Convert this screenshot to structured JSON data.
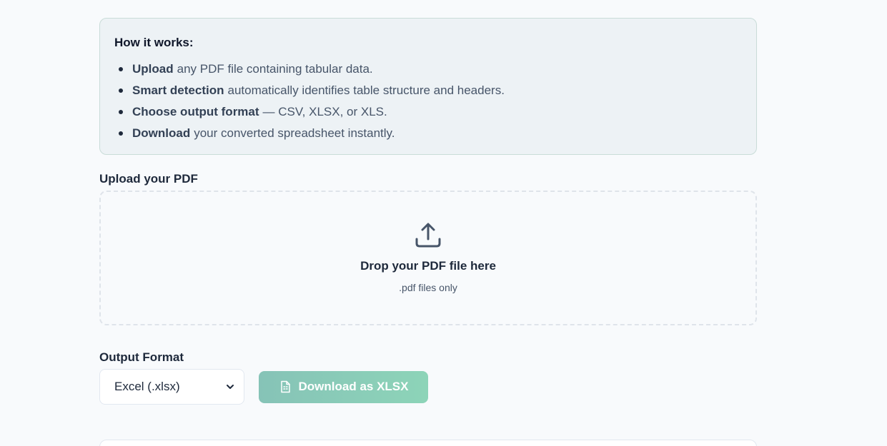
{
  "info": {
    "title": "How it works:",
    "items": [
      {
        "bold": "Upload",
        "text": "any PDF file containing tabular data."
      },
      {
        "bold": "Smart detection",
        "text": "automatically identifies table structure and headers."
      },
      {
        "bold": "Choose output format",
        "text": "— CSV, XLSX, or XLS."
      },
      {
        "bold": "Download",
        "text": "your converted spreadsheet instantly."
      }
    ]
  },
  "upload": {
    "label": "Upload your PDF",
    "icon": "upload-icon",
    "drop_title": "Drop your PDF file here",
    "drop_sub": ".pdf files only"
  },
  "output": {
    "label": "Output Format",
    "selected": "Excel (.xlsx)",
    "download_label": "Download as XLSX",
    "download_icon": "file-spreadsheet-icon"
  },
  "colors": {
    "accent_start": "#86c3b7",
    "accent_end": "#8dd4b8",
    "info_bg": "#edf2f5"
  }
}
